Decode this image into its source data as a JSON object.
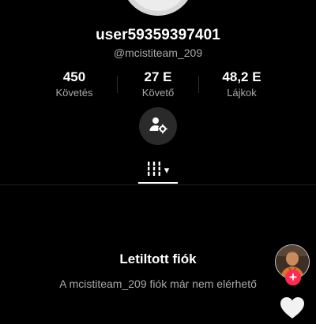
{
  "profile": {
    "username": "user59359397401",
    "handle": "@mcistiteam_209"
  },
  "stats": [
    {
      "value": "450",
      "label": "Követés"
    },
    {
      "value": "27 E",
      "label": "Követő"
    },
    {
      "value": "48,2 E",
      "label": "Lájkok"
    }
  ],
  "icons": {
    "action": "user-settings-icon",
    "tab": "videos-grid-icon",
    "side_action": "heart-icon",
    "follow": "plus-icon"
  },
  "tab_dropdown": {
    "arrow": "▾"
  },
  "blocked": {
    "title": "Letiltott fiók",
    "message": "A mcistiteam_209 fiók már nem elérhető"
  },
  "sidebar": {
    "follow_symbol": "+"
  },
  "colors": {
    "background": "#000000",
    "text_primary": "#ffffff",
    "text_secondary": "#a9a9a9",
    "accent": "#fe2c55",
    "button_bg": "#2a2a2a"
  }
}
